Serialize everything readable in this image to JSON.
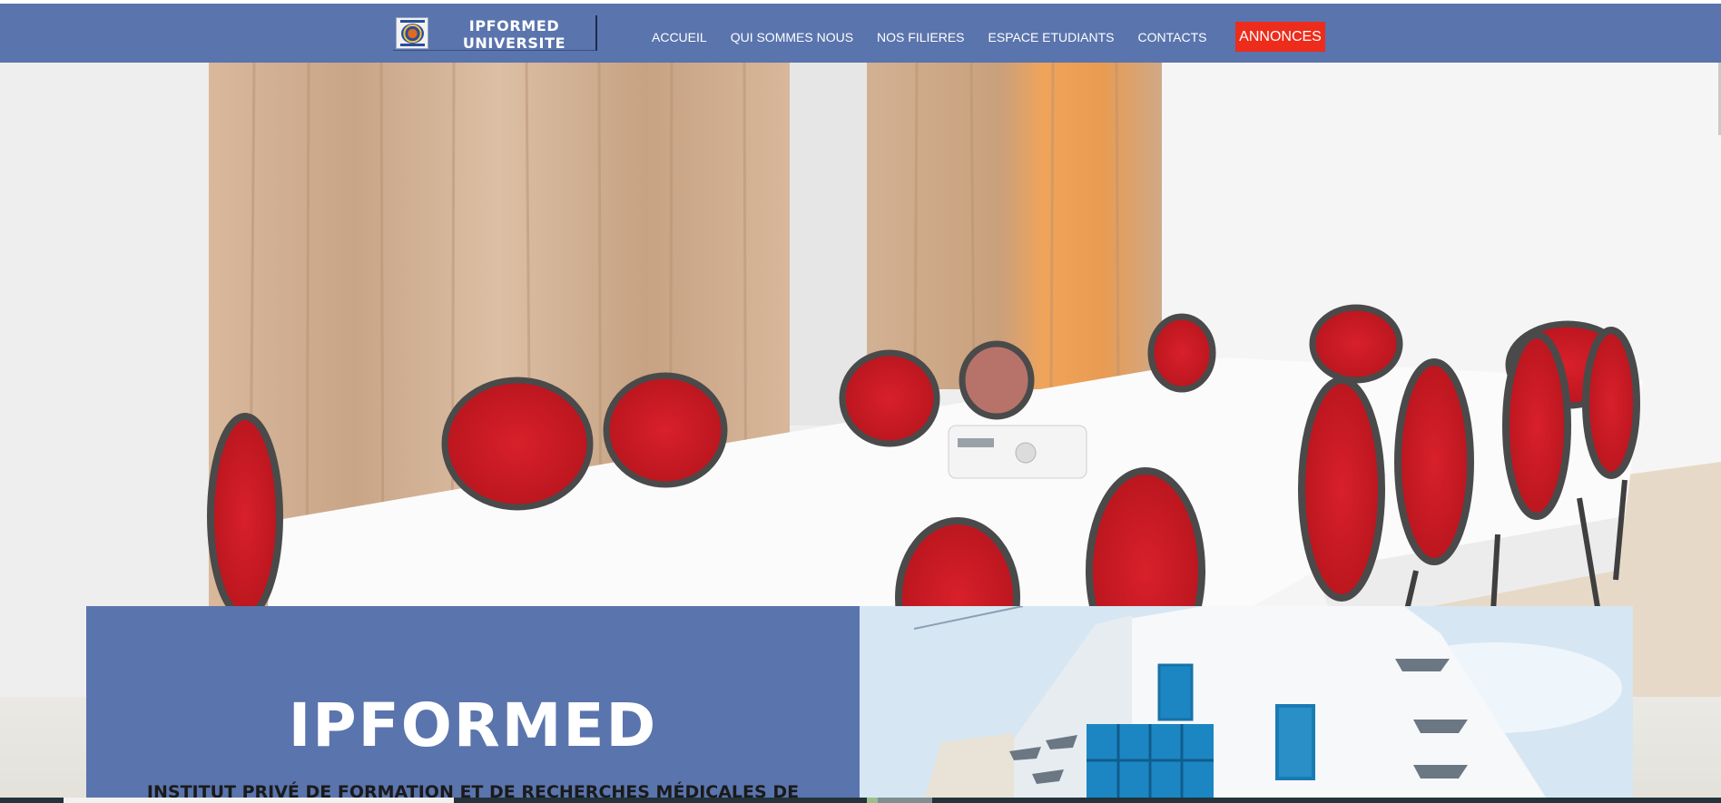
{
  "header": {
    "logo_lines": [
      "IPFORMED",
      "UNIVERSITE"
    ],
    "nav": [
      "ACCUEIL",
      "QUI SOMMES NOUS",
      "NOS FILIERES",
      "ESPACE ETUDIANTS",
      "CONTACTS"
    ],
    "announce_label": "ANNONCES"
  },
  "card": {
    "title": "IPFORMED",
    "subtitle": "INSTITUT PRIVÉ DE FORMATION ET DE RECHERCHES MÉDICALES DE"
  },
  "colors": {
    "header_bg": "#5a74ad",
    "announce_bg": "#ed2c1c",
    "card_bg": "#5a74ad"
  },
  "icons": {
    "logo_emblem": "university-emblem-icon"
  }
}
